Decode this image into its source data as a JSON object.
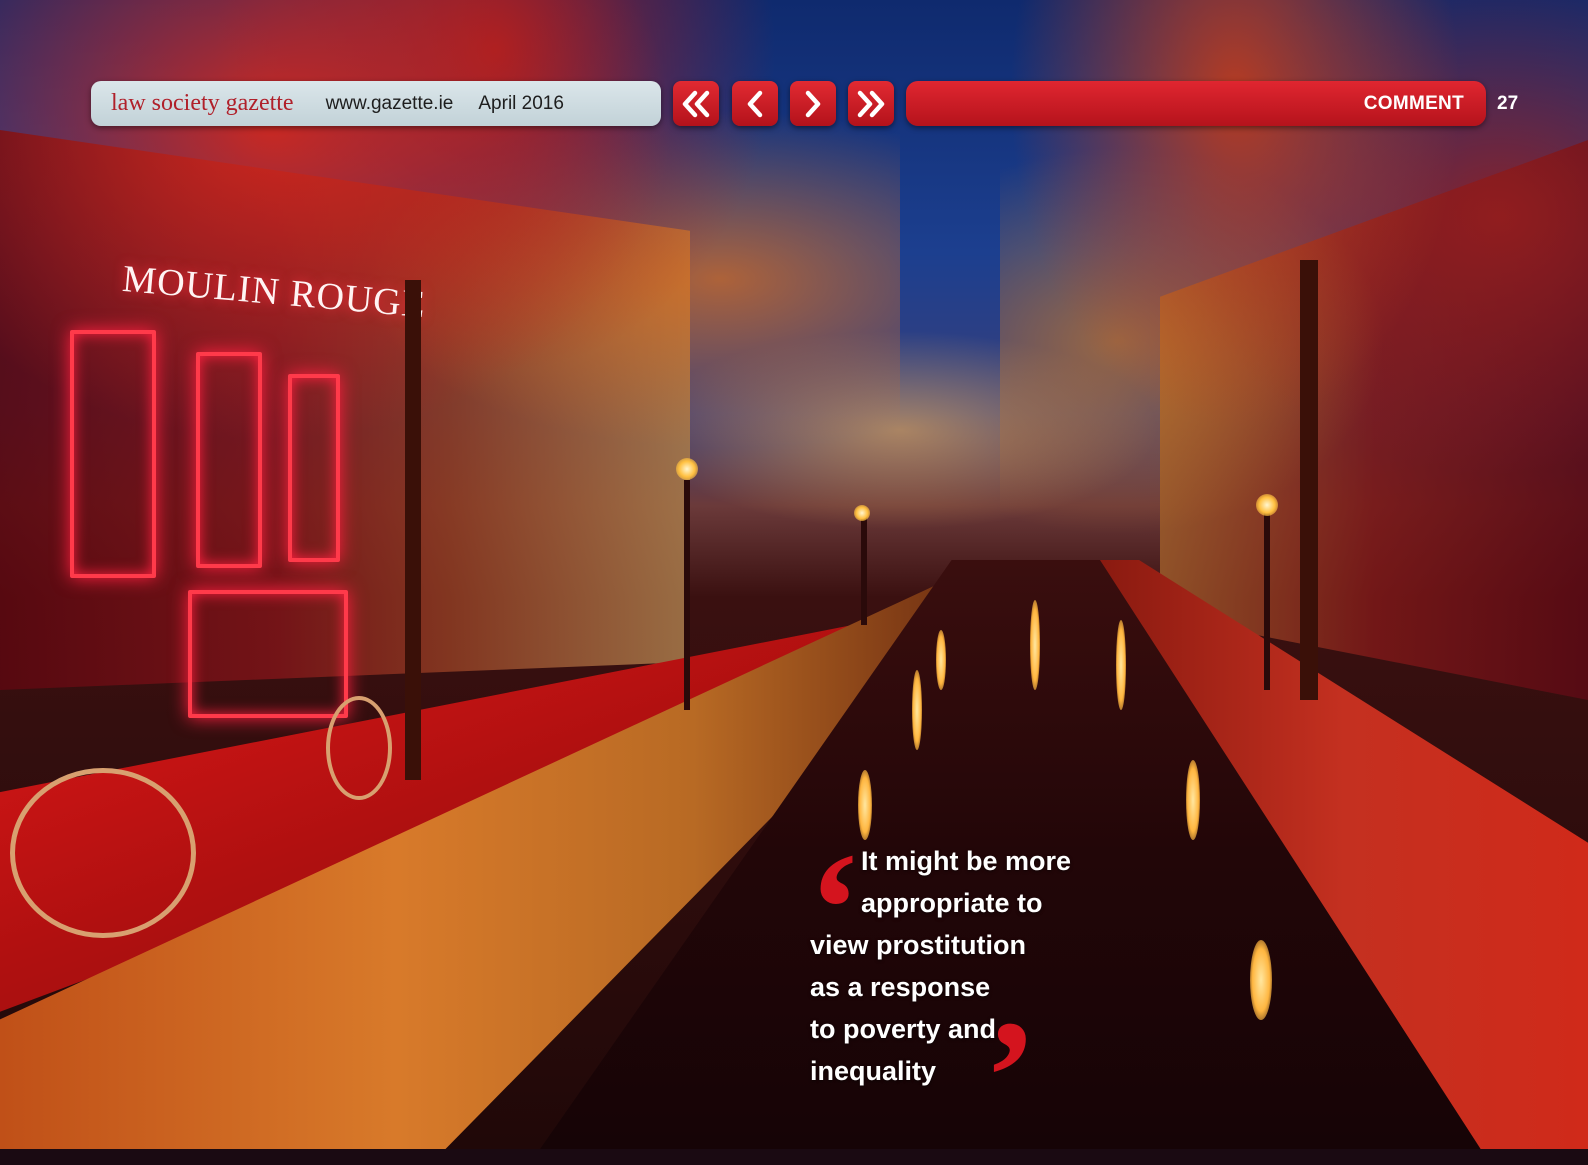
{
  "header": {
    "brand": "law society gazette",
    "url": "www.gazette.ie",
    "issue": "April 2016",
    "section": "COMMENT",
    "page_number": "27"
  },
  "nav": [
    {
      "name": "first-page",
      "icon": "double-chevron-left-icon"
    },
    {
      "name": "previous-page",
      "icon": "chevron-left-icon"
    },
    {
      "name": "next-page",
      "icon": "chevron-right-icon"
    },
    {
      "name": "last-page",
      "icon": "double-chevron-right-icon"
    }
  ],
  "photo": {
    "sign_text": "MOULIN ROUGE"
  },
  "pull_quote": {
    "open_mark": "‘",
    "close_mark": "’",
    "lines": [
      "It might be more",
      "appropriate to",
      "view prostitution",
      "as a response",
      "to poverty and",
      "inequality"
    ]
  },
  "colors": {
    "brand_red": "#b0202a",
    "bar_red": "#c8161f",
    "quote_mark_red": "#d4141e",
    "masthead_grey": "#c9d8de"
  }
}
